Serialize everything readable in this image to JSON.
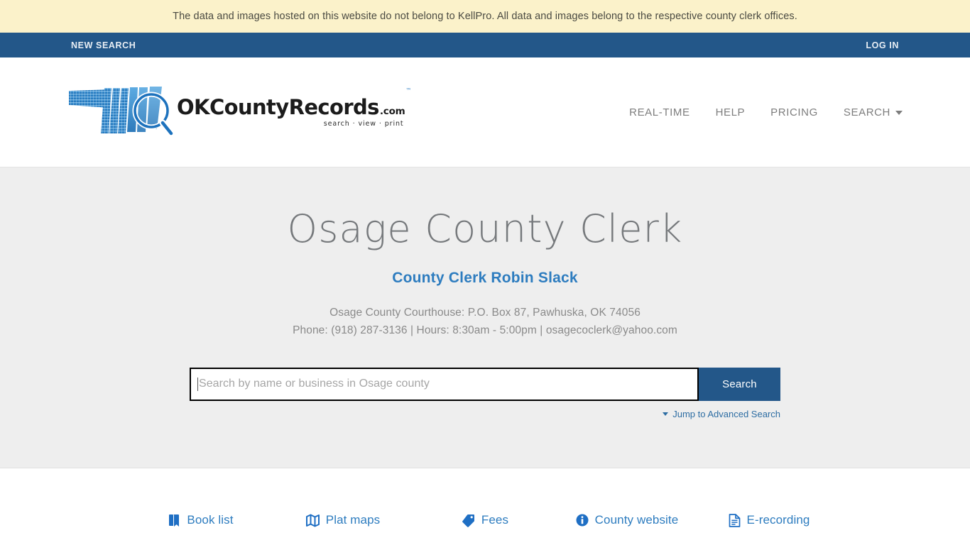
{
  "notice": {
    "text": "The data and images hosted on this website do not belong to KellPro. All data and images belong to the respective county clerk offices."
  },
  "utility_bar": {
    "new_search": "NEW SEARCH",
    "log_in": "LOG IN"
  },
  "brand": {
    "name_ok": "OK",
    "name_county": "County",
    "name_records": "Records",
    "dotcom": ".com",
    "tagline": "search · view · print",
    "tm": "™"
  },
  "nav": {
    "items": [
      {
        "label": "REAL-TIME",
        "icon": ""
      },
      {
        "label": "HELP",
        "icon": ""
      },
      {
        "label": "PRICING",
        "icon": ""
      },
      {
        "label": "SEARCH",
        "icon": "chevron-down-icon"
      }
    ]
  },
  "hero": {
    "title": "Osage County Clerk",
    "clerk": "County Clerk Robin Slack",
    "address": "Osage County Courthouse: P.O. Box 87, Pawhuska, OK 74056",
    "contact": "Phone: (918) 287-3136 | Hours: 8:30am - 5:00pm | osagecoclerk@yahoo.com"
  },
  "search": {
    "placeholder": "Search by name or business in Osage county",
    "value": "",
    "button_label": "Search",
    "advanced_label": "Jump to Advanced Search"
  },
  "quicklinks": [
    {
      "label": "Book list",
      "icon": "book-icon"
    },
    {
      "label": "Plat maps",
      "icon": "map-icon"
    },
    {
      "label": "Fees",
      "icon": "tag-icon"
    },
    {
      "label": "County website",
      "icon": "info-circle-icon"
    },
    {
      "label": "E-recording",
      "icon": "document-icon"
    }
  ],
  "colors": {
    "banner_yellow": "#fbf2ca",
    "nav_blue": "#235789",
    "hero_bg": "#eeeeee",
    "link_blue": "#2d7cbf",
    "title_gray": "#76797c"
  }
}
